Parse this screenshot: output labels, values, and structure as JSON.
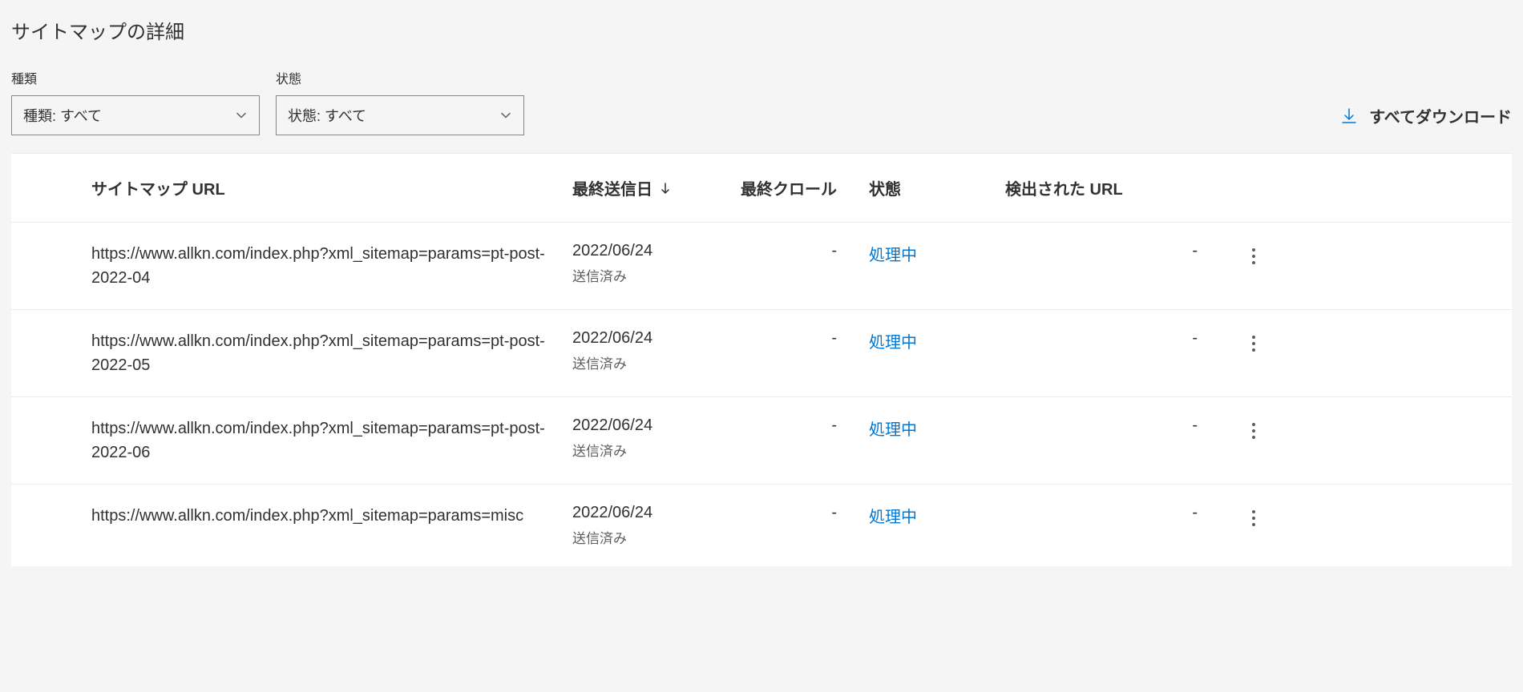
{
  "page": {
    "title": "サイトマップの詳細"
  },
  "filters": {
    "type": {
      "label": "種類",
      "value": "種類: すべて"
    },
    "status": {
      "label": "状態",
      "value": "状態: すべて"
    }
  },
  "download": {
    "label": "すべてダウンロード"
  },
  "table": {
    "headers": {
      "url": "サイトマップ URL",
      "last_sent": "最終送信日",
      "last_crawl": "最終クロール",
      "status": "状態",
      "detected_urls": "検出された URL"
    },
    "rows": [
      {
        "url": "https://www.allkn.com/index.php?xml_sitemap=params=pt-post-2022-04",
        "last_sent_date": "2022/06/24",
        "last_sent_status": "送信済み",
        "last_crawl": "-",
        "status": "処理中",
        "detected_urls": "-"
      },
      {
        "url": "https://www.allkn.com/index.php?xml_sitemap=params=pt-post-2022-05",
        "last_sent_date": "2022/06/24",
        "last_sent_status": "送信済み",
        "last_crawl": "-",
        "status": "処理中",
        "detected_urls": "-"
      },
      {
        "url": "https://www.allkn.com/index.php?xml_sitemap=params=pt-post-2022-06",
        "last_sent_date": "2022/06/24",
        "last_sent_status": "送信済み",
        "last_crawl": "-",
        "status": "処理中",
        "detected_urls": "-"
      },
      {
        "url": "https://www.allkn.com/index.php?xml_sitemap=params=misc",
        "last_sent_date": "2022/06/24",
        "last_sent_status": "送信済み",
        "last_crawl": "-",
        "status": "処理中",
        "detected_urls": "-"
      }
    ]
  }
}
